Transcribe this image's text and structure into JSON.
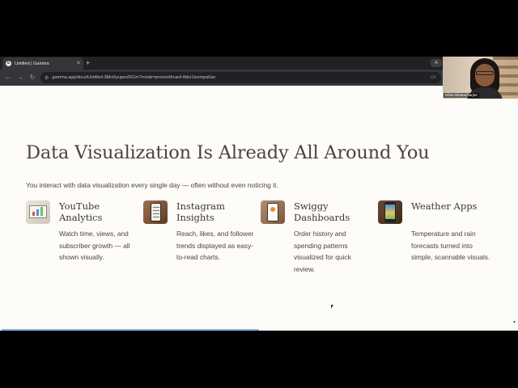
{
  "browser": {
    "tab_title": "Untitled | Gamma",
    "tab_favicon_letter": "G",
    "tab_close": "×",
    "new_tab": "+",
    "extension_label": "A",
    "url": "gamma.app/docs/Untitled-38kx5yupoo501m?mode=present#card-tfdxr1iszmpa0an"
  },
  "slide": {
    "title": "Data Visualization Is Already All Around You",
    "subtitle": "You interact with data visualization every single day — often without even noticing it.",
    "cards": [
      {
        "title": "YouTube Analytics",
        "desc": "Watch time, views, and subscriber growth — all shown visually."
      },
      {
        "title": "Instagram Insights",
        "desc": "Reach, likes, and follower trends displayed as easy-to-read charts."
      },
      {
        "title": "Swiggy Dashboards",
        "desc": "Order history and spending patterns visualized for quick review."
      },
      {
        "title": "Weather Apps",
        "desc": "Temperature and rain forecasts turned into simple, scannable visuals."
      }
    ]
  },
  "presentation_progress": 0.5,
  "video_call": {
    "participant_name": "Ishita Bhattacharjee"
  }
}
